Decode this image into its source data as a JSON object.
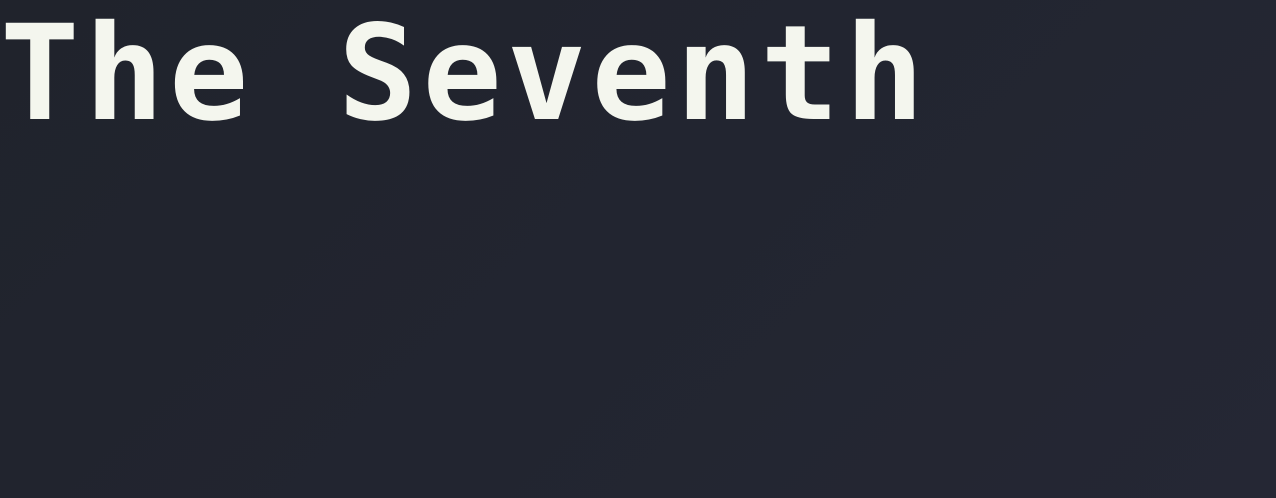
{
  "title": {
    "text": "The Seventh"
  },
  "colors": {
    "background": "#222530",
    "title_text": "#f4f6ee"
  }
}
